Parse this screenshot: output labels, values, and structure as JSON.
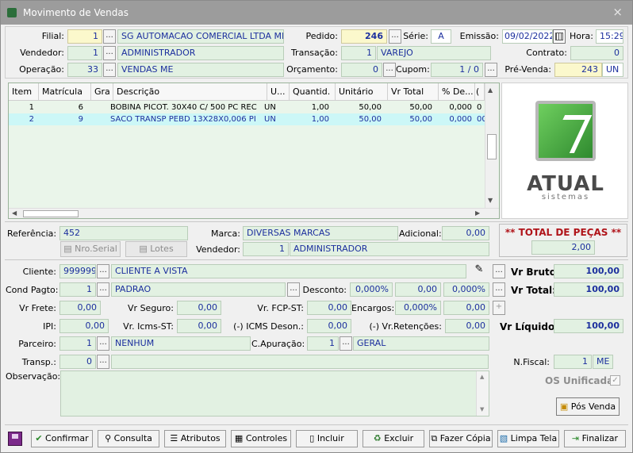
{
  "window": {
    "title": "Movimento de Vendas",
    "close": "×"
  },
  "header": {
    "filial_label": "Filial:",
    "filial_code": "1",
    "filial_name": "SG AUTOMACAO COMERCIAL LTDA ME",
    "vendedor_label": "Vendedor:",
    "vendedor_code": "1",
    "vendedor_name": "ADMINISTRADOR",
    "operacao_label": "Operação:",
    "operacao_code": "33",
    "operacao_name": "VENDAS ME",
    "pedido_label": "Pedido:",
    "pedido": "246",
    "serie_label": "Série:",
    "serie": "A",
    "emissao_label": "Emissão:",
    "emissao": "09/02/2022",
    "hora_label": "Hora:",
    "hora": "15:29",
    "transacao_label": "Transação:",
    "transacao_code": "1",
    "transacao_name": "VAREJO",
    "contrato_label": "Contrato:",
    "contrato": "0",
    "orcamento_label": "Orçamento:",
    "orcamento": "0",
    "cupom_label": "Cupom:",
    "cupom": "1 / 0",
    "prevenda_label": "Pré-Venda:",
    "prevenda": "243",
    "prevenda_un": "UN"
  },
  "grid": {
    "columns": [
      "Item",
      "Matrícula",
      "Gra",
      "Descrição",
      "U...",
      "Quantid.",
      "Unitário",
      "Vr Total",
      "% De...",
      "("
    ],
    "rows": [
      [
        "1",
        "6",
        "",
        "BOBINA PICOT. 30X40 C/ 500 PC REC",
        "UN",
        "1,00",
        "50,00",
        "50,00",
        "0,000",
        "0"
      ],
      [
        "2",
        "9",
        "",
        "SACO TRANSP PEBD 13X28X0,006 PI",
        "UN",
        "1,00",
        "50,00",
        "50,00",
        "0,000",
        "00"
      ]
    ]
  },
  "logo": {
    "name": "ATUAL",
    "sub": "sistemas"
  },
  "detail": {
    "referencia_label": "Referência:",
    "referencia": "452",
    "marca_label": "Marca:",
    "marca": "DIVERSAS MARCAS",
    "adicional_label": "Adicional:",
    "adicional": "0,00",
    "nro_serial": "Nro.Serial",
    "lotes": "Lotes",
    "vendedor_label": "Vendedor:",
    "vendedor_code": "1",
    "vendedor_name": "ADMINISTRADOR",
    "total_pecas_label": "** TOTAL DE PEÇAS **",
    "total_pecas": "2,00"
  },
  "footer": {
    "cliente_label": "Cliente:",
    "cliente_code": "999999",
    "cliente_name": "CLIENTE A VISTA",
    "vr_bruto_label": "Vr Bruto:",
    "vr_bruto": "100,00",
    "cond_label": "Cond Pagto:",
    "cond_code": "1",
    "cond_name": "PADRAO",
    "desconto_label": "Desconto:",
    "desconto_pct": "0,000%",
    "desconto_val": "0,00",
    "desconto_pct2": "0,000%",
    "vr_total_label": "Vr Total:",
    "vr_total": "100,00",
    "frete_label": "Vr Frete:",
    "frete": "0,00",
    "seguro_label": "Vr Seguro:",
    "seguro": "0,00",
    "fcp_label": "Vr. FCP-ST:",
    "fcp": "0,00",
    "encargos_label": "Encargos:",
    "encargos_pct": "0,000%",
    "encargos_val": "0,00",
    "ipi_label": "IPI:",
    "ipi": "0,00",
    "icmsst_label": "Vr. Icms-ST:",
    "icmsst": "0,00",
    "icmsdeson_label": "(-) ICMS Deson.:",
    "icmsdeson": "0,00",
    "retencoes_label": "(-) Vr.Retenções:",
    "retencoes": "0,00",
    "vr_liquido_label": "Vr Líquido:",
    "vr_liquido": "100,00",
    "parceiro_label": "Parceiro:",
    "parceiro_code": "1",
    "parceiro_name": "NENHUM",
    "capuracao_label": "C.Apuração:",
    "capuracao_code": "1",
    "capuracao_name": "GERAL",
    "transp_label": "Transp.:",
    "transp_code": "0",
    "nfiscal_label": "N.Fiscal:",
    "nfiscal": "1",
    "nfiscal_tipo": "ME",
    "obs_label": "Observação:",
    "os_unificada": "OS Unificada",
    "pos_venda": "Pós Venda"
  },
  "toolbar": {
    "confirmar": "Confirmar",
    "consulta": "Consulta",
    "atributos": "Atributos",
    "controles": "Controles",
    "incluir": "Incluir",
    "excluir": "Excluir",
    "fazer_copia": "Fazer Cópia",
    "limpa_tela": "Limpa Tela",
    "finalizar": "Finalizar"
  }
}
